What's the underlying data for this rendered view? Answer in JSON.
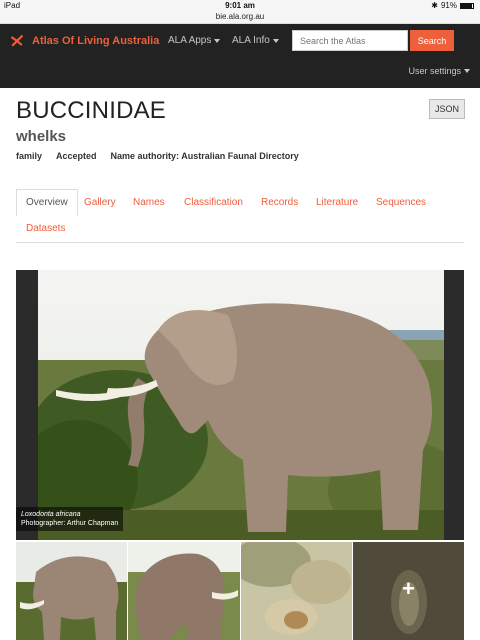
{
  "status_bar": {
    "device": "iPad",
    "time": "9:01 am",
    "battery": "91%",
    "url": "bie.ala.org.au"
  },
  "navbar": {
    "brand": "Atlas Of Living Australia",
    "apps_label": "ALA Apps",
    "info_label": "ALA Info",
    "search_placeholder": "Search the Atlas",
    "search_button": "Search",
    "user_settings": "User settings"
  },
  "taxon": {
    "name": "BUCCINIDAE",
    "common_name": "whelks",
    "rank": "family",
    "status": "Accepted",
    "authority_label": "Name authority:",
    "authority": "Australian Faunal Directory",
    "json_button": "JSON"
  },
  "tabs": [
    {
      "label": "Overview",
      "active": true
    },
    {
      "label": "Gallery"
    },
    {
      "label": "Names"
    },
    {
      "label": "Classification"
    },
    {
      "label": "Records"
    },
    {
      "label": "Literature"
    },
    {
      "label": "Sequences"
    },
    {
      "label": "Datasets"
    }
  ],
  "gallery": {
    "caption_species": "Loxodonta africana",
    "caption_photographer": "Photographer: Arthur Chapman",
    "more_icon": "+"
  },
  "colors": {
    "accent": "#ee5f3b",
    "navbar": "#222222"
  }
}
